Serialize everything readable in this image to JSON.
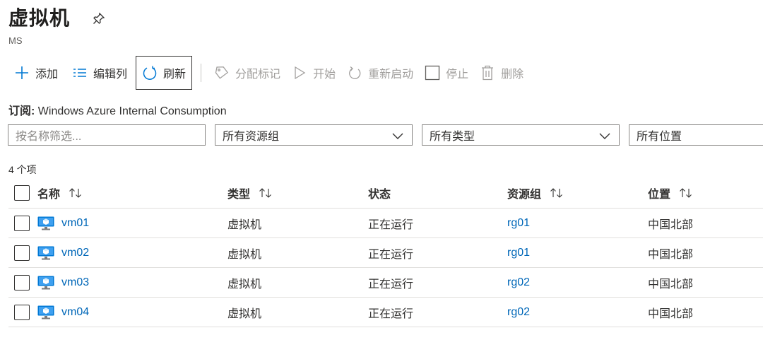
{
  "header": {
    "title": "虚拟机",
    "subtitle": "MS"
  },
  "toolbar": {
    "add": "添加",
    "edit_columns": "编辑列",
    "refresh": "刷新",
    "assign_tags": "分配标记",
    "start": "开始",
    "restart": "重新启动",
    "stop": "停止",
    "delete": "删除"
  },
  "subscription": {
    "label": "订阅:",
    "value": "Windows Azure Internal Consumption"
  },
  "filters": {
    "search_placeholder": "按名称筛选...",
    "resource_group": "所有资源组",
    "type": "所有类型",
    "location": "所有位置"
  },
  "item_count": "4 个项",
  "columns": {
    "name": "名称",
    "type": "类型",
    "status": "状态",
    "resource_group": "资源组",
    "location": "位置"
  },
  "rows": [
    {
      "name": "vm01",
      "type": "虚拟机",
      "status": "正在运行",
      "resource_group": "rg01",
      "location": "中国北部"
    },
    {
      "name": "vm02",
      "type": "虚拟机",
      "status": "正在运行",
      "resource_group": "rg01",
      "location": "中国北部"
    },
    {
      "name": "vm03",
      "type": "虚拟机",
      "status": "正在运行",
      "resource_group": "rg02",
      "location": "中国北部"
    },
    {
      "name": "vm04",
      "type": "虚拟机",
      "status": "正在运行",
      "resource_group": "rg02",
      "location": "中国北部"
    }
  ],
  "colors": {
    "link": "#0067b8",
    "accent": "#0078d4",
    "disabled": "#a19f9d"
  }
}
